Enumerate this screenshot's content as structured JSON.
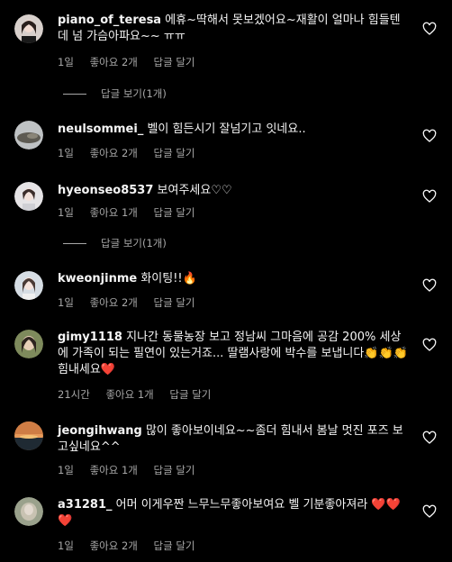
{
  "comments": [
    {
      "user": "piano_of_teresa",
      "text": "에휴~딱해서 못보겠어요~재활이 얼마나 힘들텐데 넘 가슴아파요~~ ㅠㅠ",
      "time": "1일",
      "likes": "좋아요 2개",
      "reply": "답글 달기",
      "view_replies": "답글 보기(1개)"
    },
    {
      "user": "neulsommei_",
      "text": "벨이 힘든시기 잘넘기고 잇네요..",
      "time": "1일",
      "likes": "좋아요 2개",
      "reply": "답글 달기"
    },
    {
      "user": "hyeonseo8537",
      "text": "보여주세요♡♡",
      "time": "1일",
      "likes": "좋아요 1개",
      "reply": "답글 달기",
      "view_replies": "답글 보기(1개)"
    },
    {
      "user": "kweonjinme",
      "text": "화이팅!!🔥",
      "time": "1일",
      "likes": "좋아요 2개",
      "reply": "답글 달기"
    },
    {
      "user": "gimy1118",
      "text": "지나간 동물농장 보고 정남씨 그마음에 공감 200% 세상에 가족이 되는 필연이 있는거죠... 딸램사랑에 박수를 보냅니다👏👏👏 힘내세요❤️",
      "time": "21시간",
      "likes": "좋아요 1개",
      "reply": "답글 달기"
    },
    {
      "user": "jeongihwang",
      "text": "많이 좋아보이네요~~좀더 힘내서 봄날 멋진 포즈 보고싶네요^^",
      "time": "1일",
      "likes": "좋아요 1개",
      "reply": "답글 달기"
    },
    {
      "user": "a31281_",
      "text": "어머 이게우짠 느무느무좋아보여요 벨 기분좋아져라 ❤️❤️❤️",
      "time": "1일",
      "likes": "좋아요 2개",
      "reply": "답글 달기"
    }
  ],
  "colors": {
    "background": "#000000",
    "primary_text": "#f5f5f5",
    "secondary_text": "#a8a8a8",
    "like_red": "#ed4956"
  }
}
